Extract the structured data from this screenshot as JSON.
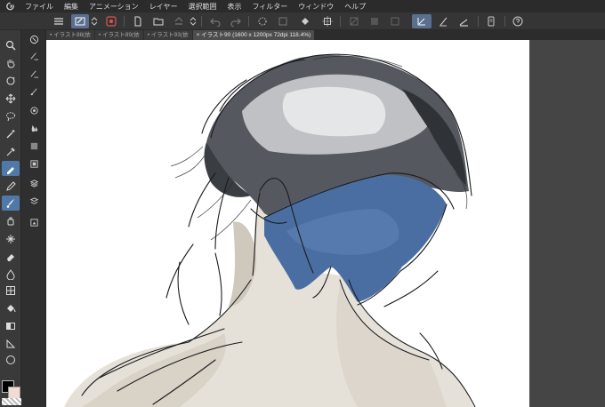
{
  "menubar": {
    "app_icon": "clip-studio-logo",
    "items": [
      "ファイル",
      "編集",
      "アニメーション",
      "レイヤー",
      "選択範囲",
      "表示",
      "フィルター",
      "ウィンドウ",
      "ヘルプ"
    ]
  },
  "tabs": [
    {
      "label": "• イラスト88(依",
      "active": false
    },
    {
      "label": "• イラスト89(依",
      "active": false
    },
    {
      "label": "• イラスト93(依",
      "active": false
    },
    {
      "label": "× イラスト90 (1600 x 1200px 72dpi 118.4%)",
      "active": true
    }
  ],
  "colors": {
    "main": "#000000",
    "sub": "#f1dcd3",
    "accent": "#4f79a8",
    "hair_blue": "#4a6ea2"
  }
}
